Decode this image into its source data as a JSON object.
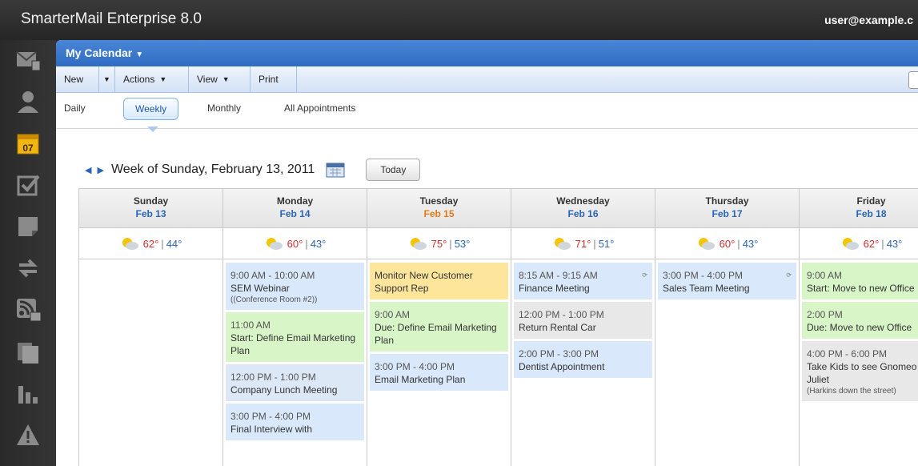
{
  "app": {
    "title": "SmarterMail Enterprise 8.0",
    "user": "user@example.c"
  },
  "header": {
    "title": "My Calendar"
  },
  "toolbar": {
    "new": "New",
    "actions": "Actions",
    "view": "View",
    "print": "Print"
  },
  "tabs": [
    "Daily",
    "Weekly",
    "Monthly",
    "All Appointments"
  ],
  "week": {
    "title": "Week of Sunday, February 13, 2011",
    "today_label": "Today"
  },
  "days": [
    {
      "name": "Sunday",
      "date": "Feb 13",
      "hi": "62°",
      "lo": "44°"
    },
    {
      "name": "Monday",
      "date": "Feb 14",
      "hi": "60°",
      "lo": "43°"
    },
    {
      "name": "Tuesday",
      "date": "Feb 15",
      "hi": "75°",
      "lo": "53°"
    },
    {
      "name": "Wednesday",
      "date": "Feb 16",
      "hi": "71°",
      "lo": "51°"
    },
    {
      "name": "Thursday",
      "date": "Feb 17",
      "hi": "60°",
      "lo": "43°"
    },
    {
      "name": "Friday",
      "date": "Feb 18",
      "hi": "62°",
      "lo": "43°"
    }
  ],
  "events": {
    "monday": [
      {
        "time": "9:00 AM - 10:00 AM",
        "title": "SEM Webinar",
        "sub": "((Conference Room #2))"
      },
      {
        "time": "11:00 AM",
        "title": "Start: Define Email Marketing Plan"
      },
      {
        "time": "12:00 PM - 1:00 PM",
        "title": "Company Lunch Meeting"
      },
      {
        "time": "3:00 PM - 4:00 PM",
        "title": "Final Interview with"
      }
    ],
    "tuesday": [
      {
        "title": "Monitor New Customer Support Rep"
      },
      {
        "time": "9:00 AM",
        "title": "Due: Define Email Marketing Plan"
      },
      {
        "time": "3:00 PM - 4:00 PM",
        "title": "Email Marketing Plan"
      }
    ],
    "wednesday": [
      {
        "time": "8:15 AM - 9:15 AM",
        "title": "Finance Meeting",
        "recur": "⟳"
      },
      {
        "time": "12:00 PM - 1:00 PM",
        "title": "Return Rental Car"
      },
      {
        "time": "2:00 PM - 3:00 PM",
        "title": "Dentist Appointment"
      }
    ],
    "thursday": [
      {
        "time": "3:00 PM - 4:00 PM",
        "title": "Sales Team Meeting",
        "recur": "⟳"
      }
    ],
    "friday": [
      {
        "time": "9:00 AM",
        "title": "Start: Move to new Office"
      },
      {
        "time": "2:00 PM",
        "title": "Due: Move to new Office"
      },
      {
        "time": "4:00 PM - 6:00 PM",
        "title": "Take Kids to see Gnomeo & Juliet",
        "sub": "(Harkins down the street)"
      }
    ]
  },
  "rail_icons": [
    "mail-icon",
    "contacts-icon",
    "calendar-icon",
    "tasks-icon",
    "notes-icon",
    "sync-icon",
    "rss-icon",
    "files-icon",
    "reports-icon",
    "alert-icon"
  ],
  "colors": {
    "accent": "#2f6cc2",
    "today": "#e27a17",
    "hi_temp": "#d42c2c",
    "lo_temp": "#2a64b8"
  }
}
